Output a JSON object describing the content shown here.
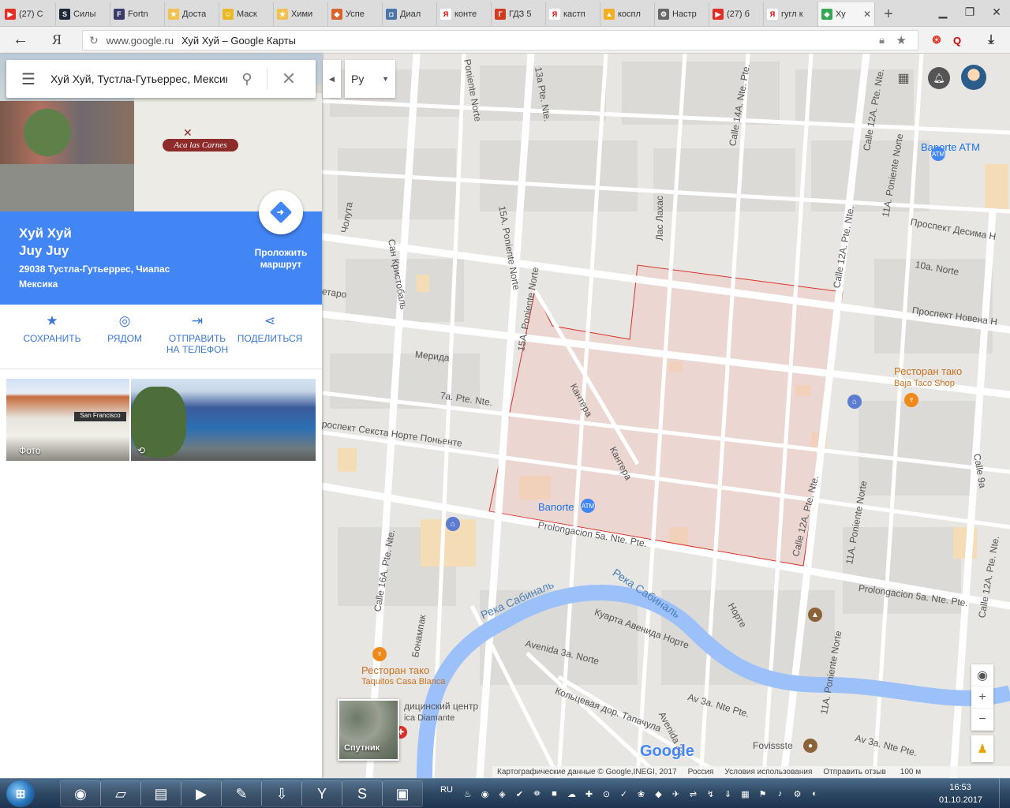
{
  "browser": {
    "tabs": [
      {
        "label": "(27) С",
        "color": "#e52d27",
        "glyph": "▶"
      },
      {
        "label": "Силы",
        "color": "#1b2838",
        "glyph": "S"
      },
      {
        "label": "Fortn",
        "color": "#3b3b6b",
        "glyph": "F"
      },
      {
        "label": "Доста",
        "color": "#f2c14e",
        "glyph": "★"
      },
      {
        "label": "Маск",
        "color": "#e8b923",
        "glyph": "☺"
      },
      {
        "label": "Хими",
        "color": "#f2c14e",
        "glyph": "★"
      },
      {
        "label": "Успе",
        "color": "#d9632b",
        "glyph": "◆"
      },
      {
        "label": "Диал",
        "color": "#4a76a8",
        "glyph": "◘"
      },
      {
        "label": "конте",
        "color": "#ffffff",
        "glyph": "Я"
      },
      {
        "label": "ГДЗ 5",
        "color": "#d23c1e",
        "glyph": "Г"
      },
      {
        "label": "кастп",
        "color": "#ffffff",
        "glyph": "Я"
      },
      {
        "label": "коспл",
        "color": "#f2b01e",
        "glyph": "▲"
      },
      {
        "label": "Настр",
        "color": "#666666",
        "glyph": "⚙"
      },
      {
        "label": "(27) б",
        "color": "#e52d27",
        "glyph": "▶"
      },
      {
        "label": "гугл к",
        "color": "#ffffff",
        "glyph": "Я"
      },
      {
        "label": "Ху",
        "color": "#34a853",
        "glyph": "◆",
        "active": true
      }
    ],
    "new_tab": "+",
    "back": "←",
    "yandex_logo": "Я",
    "url_domain": "www.google.ru",
    "page_title": "Хуй Хуй – Google Карты"
  },
  "place": {
    "search_query": "Хуй Хуй, Тустла-Гутьеррес, Мексика",
    "name_line1": "Хуй Хуй",
    "name_line2": "Juy Juy",
    "address": "29038 Тустла-Гутьеррес, Чиапас Мексика",
    "sign_text": "Aca las Carnes",
    "route_label": "Проложить маршрут",
    "actions": [
      {
        "label": "СОХРАНИТЬ",
        "icon": "star-icon",
        "glyph": "★"
      },
      {
        "label": "РЯДОМ",
        "icon": "nearby-icon",
        "glyph": "◎"
      },
      {
        "label": "ОТПРАВИТЬ НА ТЕЛЕФОН",
        "icon": "send-to-phone-icon",
        "glyph": "⇥"
      },
      {
        "label": "ПОДЕЛИТЬСЯ",
        "icon": "share-icon",
        "glyph": "⋖"
      }
    ],
    "photo1_label": "Фото",
    "photo1_sign": "San Francisco",
    "photo2_icon": "360-view-icon"
  },
  "map": {
    "lang_selected": "Ру",
    "satellite_label": "Спутник",
    "google_logo": "Google",
    "attribution": "Картографические данные © Google,INEGI, 2017",
    "country": "Россия",
    "terms": "Условия использования",
    "feedback": "Отправить отзыв",
    "scale": "100 м",
    "zoom_in": "+",
    "zoom_out": "−",
    "labels": {
      "poniente_norte_top": "Poniente Norte",
      "pte_13a": "13a Pte. Nte.",
      "calle_14a": "Calle 14A. Nte. Pte.",
      "calle_12a_top": "Calle 12A. Pte. Nte.",
      "banorte_atm": "Banorte ATM",
      "choluta": "Чолута",
      "san_kristobal": "Сан Кристобаль",
      "las_lahas": "Лас Лахас",
      "pte_15a": "15A. Poniente Norte",
      "desima": "Проспект Десима Н",
      "calle_12a_mid": "Calle 12A. Pte. Nte.",
      "norte_10a": "10a. Norte",
      "novena": "Проспект Новена Н",
      "tarro": "етаро",
      "merida": "Мерида",
      "pte_7a": "7a. Pte. Nte.",
      "sexta": "роспект Секста Норте Поньенте",
      "pte_15a_lower": "15A. Poniente Norte",
      "kantera1": "Кантера",
      "kantera2": "Кантера",
      "taco1": "Ресторан тако",
      "taco1_sub": "Baja Taco Shop",
      "banorte2": "Banorte",
      "prolongacion1": "Prolongacion 5a. Nte. Pte.",
      "calle_12a_low": "Calle 12A. Pte. Nte.",
      "pte_11a_mid": "11A. Poniente Norte",
      "pte_16a": "Calle 16A. Pte. Nte.",
      "bonampak": "Бонампак",
      "river1": "Река Сабиналь",
      "river2": "Река Сабиналь",
      "prolongacion2": "Prolongacion 5a. Nte. Pte.",
      "norte_small": "Норте",
      "kuarta": "Куарта Авенида Норте",
      "avenida3a": "Avenida 3a. Norte",
      "taco2": "Ресторан тако",
      "taco2_sub": "Taquitos Casa Blanca",
      "med_center": "дицинский центр",
      "med_sub": "ica Diamante",
      "av3a_pte": "Av 3a. Nte Pte.",
      "koltsevaya": "Кольцевая дор. Тапачула",
      "avenida2a": "Avenida 2a",
      "pte_11a_low": "11A. Poniente Norte",
      "fovissste": "Fovissste",
      "av3a_pte2": "Av 3a. Nte Pte.",
      "calle_9a": "Calle 9a",
      "pte_11a_top": "11A. Poniente Norte",
      "calle_12a_right": "Calle 12A. Pte. Nte."
    }
  },
  "taskbar": {
    "start_glyph": "⊞",
    "lang": "RU",
    "time": "16:53",
    "date": "01.10.2017",
    "buttons": [
      {
        "name": "media-player-button",
        "glyph": "◉"
      },
      {
        "name": "notes-button",
        "glyph": "▱"
      },
      {
        "name": "explorer-button",
        "glyph": "▤"
      },
      {
        "name": "video-button",
        "glyph": "▶"
      },
      {
        "name": "paint-button",
        "glyph": "✎"
      },
      {
        "name": "download-button",
        "glyph": "⇩"
      },
      {
        "name": "yandex-browser-button",
        "glyph": "Y"
      },
      {
        "name": "skype-button",
        "glyph": "S"
      },
      {
        "name": "photos-button",
        "glyph": "▣"
      }
    ],
    "tray": [
      "♨",
      "◉",
      "◈",
      "✔",
      "⛯",
      "■",
      "☁",
      "✚",
      "⊙",
      "✓",
      "❀",
      "◆",
      "✈",
      "⇌",
      "↯",
      "⇓",
      "▦",
      "⚑",
      "♪",
      "⚙",
      "◐"
    ]
  },
  "colors": {
    "accent_blue": "#4285f4",
    "highlight_fill": "rgba(242,200,196,0.45)",
    "highlight_border": "#d9322a",
    "river": "#8ab4f8",
    "road": "#ffffff",
    "block": "#e5e3df"
  }
}
